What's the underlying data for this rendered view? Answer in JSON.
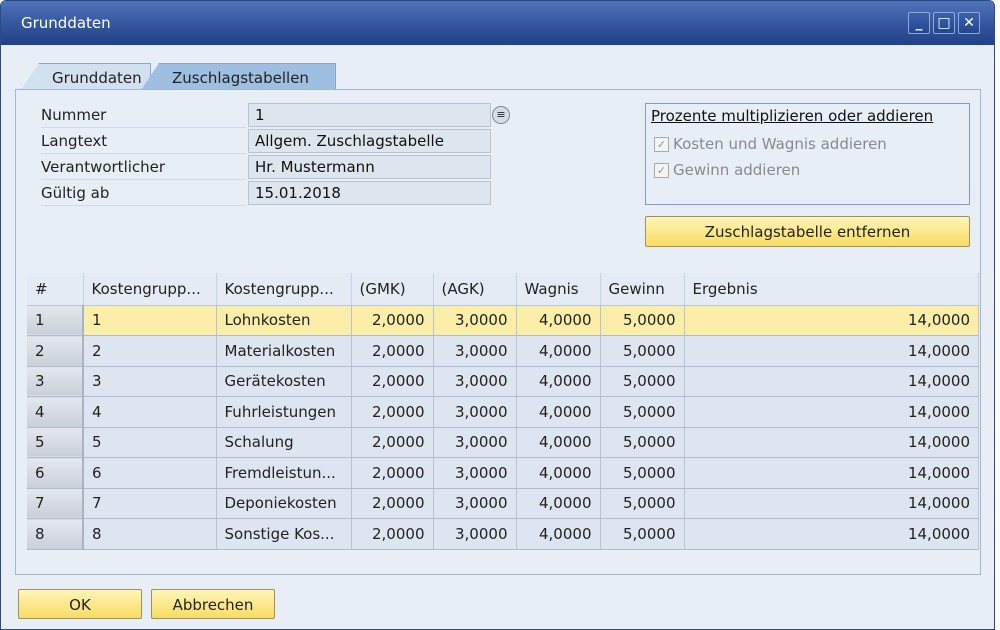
{
  "window": {
    "title": "Grunddaten",
    "min": "_",
    "max": "□",
    "close": "✕"
  },
  "tabs": [
    {
      "label": "Grunddaten"
    },
    {
      "label": "Zuschlagstabellen"
    }
  ],
  "form": {
    "nummer": {
      "label": "Nummer",
      "value": "1"
    },
    "langtext": {
      "label": "Langtext",
      "value": "Allgem. Zuschlagstabelle"
    },
    "verantwortlicher": {
      "label": "Verantwortlicher",
      "value": "Hr. Mustermann"
    },
    "gueltig": {
      "label": "Gültig ab",
      "value": "15.01.2018"
    }
  },
  "group": {
    "title": "Prozente multiplizieren oder addieren",
    "cb1": "Kosten und Wagnis addieren",
    "cb2": "Gewinn addieren"
  },
  "remove_button": "Zuschlagstabelle entfernen",
  "table": {
    "headers": [
      "#",
      "Kostengrupp...",
      "Kostengrupp...",
      "(GMK)",
      "(AGK)",
      "Wagnis",
      "Gewinn",
      "Ergebnis"
    ],
    "rows": [
      [
        "1",
        "1",
        "Lohnkosten",
        "2,0000",
        "3,0000",
        "4,0000",
        "5,0000",
        "14,0000"
      ],
      [
        "2",
        "2",
        "Materialkosten",
        "2,0000",
        "3,0000",
        "4,0000",
        "5,0000",
        "14,0000"
      ],
      [
        "3",
        "3",
        "Gerätekosten",
        "2,0000",
        "3,0000",
        "4,0000",
        "5,0000",
        "14,0000"
      ],
      [
        "4",
        "4",
        "Fuhrleistungen",
        "2,0000",
        "3,0000",
        "4,0000",
        "5,0000",
        "14,0000"
      ],
      [
        "5",
        "5",
        "Schalung",
        "2,0000",
        "3,0000",
        "4,0000",
        "5,0000",
        "14,0000"
      ],
      [
        "6",
        "6",
        "Fremdleistun...",
        "2,0000",
        "3,0000",
        "4,0000",
        "5,0000",
        "14,0000"
      ],
      [
        "7",
        "7",
        "Deponiekosten",
        "2,0000",
        "3,0000",
        "4,0000",
        "5,0000",
        "14,0000"
      ],
      [
        "8",
        "8",
        "Sonstige Kos...",
        "2,0000",
        "3,0000",
        "4,0000",
        "5,0000",
        "14,0000"
      ]
    ]
  },
  "buttons": {
    "ok": "OK",
    "cancel": "Abbrechen"
  }
}
